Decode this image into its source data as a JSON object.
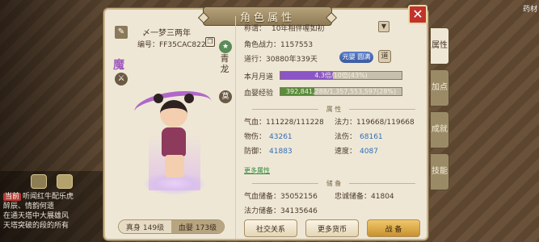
{
  "panel": {
    "title": "角色属性"
  },
  "top_right": "药材",
  "chat": {
    "lines": [
      {
        "tag": "当前",
        "text": "听闻红牛配乐虎"
      },
      {
        "tag": "",
        "text": "醉辰、情韵何遗"
      },
      {
        "tag": "",
        "text": "在通天塔中大展雄风"
      },
      {
        "tag": "",
        "text": "天塔突破的段的所有"
      }
    ]
  },
  "character": {
    "name": "〆一梦三两年",
    "id_label": "编号：",
    "id_value": "FF35CAC822",
    "race_glyph": "魔",
    "vertical_text": "青龙",
    "badge1": "★",
    "badge2": "莫",
    "race_icon": "⚔",
    "level": {
      "real_label": "真身",
      "real_value": "149级",
      "baby_label": "血婴",
      "baby_value": "173级"
    }
  },
  "info": {
    "title_label": "称谓：",
    "title_value": "10年相伴喔如初",
    "power_label": "角色战力：",
    "power_value": "1157553",
    "dao_label": "道行：",
    "dao_value": "30880年339天",
    "dao_button": "元婴 圆满",
    "dao_badge": "道",
    "month_label": "本月月道",
    "month_text": "4.3倍/10倍(43%)",
    "month_pct": 43,
    "exp_label": "血婴经验",
    "exp_text": "392,841,288/1,357,553,597(28%)",
    "exp_pct": 28
  },
  "attr_section": "属 性",
  "stats": {
    "hp_label": "气血：",
    "hp_value": "111228/111228",
    "mp_label": "法力：",
    "mp_value": "119668/119668",
    "phy_label": "物伤：",
    "phy_value": "43261",
    "mag_label": "法伤：",
    "mag_value": "68161",
    "def_label": "防御：",
    "def_value": "41883",
    "spd_label": "速度：",
    "spd_value": "4087"
  },
  "more_attr": "更多属性",
  "storage_section": "储 备",
  "storage": {
    "hp_store_label": "气血储备：",
    "hp_store_value": "35052156",
    "loyal_label": "忠诚储备：",
    "loyal_value": "41804",
    "mp_store_label": "法力储备：",
    "mp_store_value": "34135646"
  },
  "buttons": {
    "social": "社交关系",
    "currency": "更多货币",
    "battle": "战 备"
  },
  "tabs": [
    "属性",
    "加点",
    "成就",
    "技能"
  ],
  "colors": {
    "exp_bar": "#5a8c3c",
    "month_bar": "#8b55c6",
    "value_blue": "#2f6fb8"
  }
}
